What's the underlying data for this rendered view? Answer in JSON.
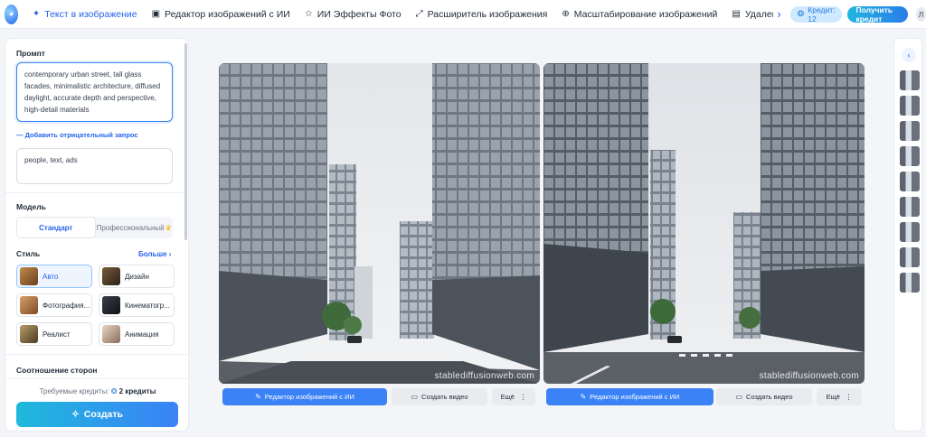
{
  "nav": {
    "tabs": [
      {
        "label": "Текст в изображение",
        "icon": "sparkle-icon",
        "active": true
      },
      {
        "label": "Редактор изображений с ИИ",
        "icon": "image-edit-icon",
        "active": false
      },
      {
        "label": "ИИ Эффекты Фото",
        "icon": "star-icon",
        "active": false
      },
      {
        "label": "Расширитель изображения",
        "icon": "expand-icon",
        "active": false
      },
      {
        "label": "Масштабирование изображений",
        "icon": "zoom-icon",
        "active": false
      },
      {
        "label": "Удаление фона",
        "icon": "eraser-icon",
        "active": false
      }
    ],
    "credit_label": "Кредит: 12",
    "get_credit_label": "Получить кредит",
    "user_initial": "Л"
  },
  "form": {
    "prompt_label": "Промпт",
    "prompt_value": "contemporary urban street, tall glass facades, minimalistic architecture, diffused daylight, accurate depth and perspective, high-detail materials",
    "negative_link": "Добавить отрицательный запрос",
    "negative_value": "people, text, ads",
    "model_label": "Модель",
    "model_options": [
      "Стандарт",
      "Профессиональный"
    ],
    "style_label": "Стиль",
    "style_more": "Больше",
    "styles": [
      "Авто",
      "Дизайн",
      "Фотография...",
      "Кинематогр...",
      "Реалист",
      "Анимация"
    ],
    "aspect_label": "Соотношение сторон",
    "required_text": "Требуемые кредиты:",
    "required_value": "2 кредиты",
    "create_label": "Создать"
  },
  "results": {
    "watermark": "stablediffusionweb.com",
    "edit_label": "Редактор изображений с ИИ",
    "video_label": "Создать видео",
    "more_label": "Ещё"
  },
  "colors": {
    "accent": "#2563eb",
    "gradient_start": "#1fb9dc",
    "gradient_end": "#3b82f6"
  }
}
